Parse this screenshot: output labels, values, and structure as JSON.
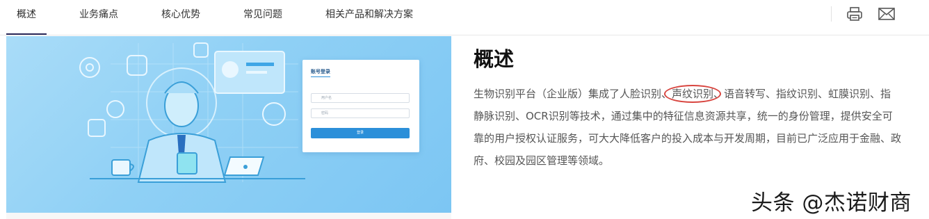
{
  "nav": {
    "tabs": [
      {
        "label": "概述",
        "active": true
      },
      {
        "label": "业务痛点",
        "active": false
      },
      {
        "label": "核心优势",
        "active": false
      },
      {
        "label": "常见问题",
        "active": false
      },
      {
        "label": "相关产品和解决方案",
        "active": false
      }
    ],
    "actions": [
      "printer-icon",
      "mail-icon"
    ]
  },
  "hero": {
    "login_card": {
      "title": "账号登录",
      "username_placeholder": "用户名",
      "password_placeholder": "密码",
      "button_label": "登录"
    }
  },
  "overview": {
    "heading": "概述",
    "text_before": "生物识别平台（企业版）集成了人脸识别、",
    "highlighted": "声纹识别",
    "text_after": "、语音转写、指纹识别、虹膜识别、指静脉识别、OCR识别等技术，通过集中的特征信息资源共享，统一的身份管理，提供安全可靠的用户授权认证服务，可大大降低客户的投入成本与开发周期，目前已广泛应用于金融、政府、校园及园区管理等领域。"
  },
  "watermark": "头条 @杰诺财商",
  "colors": {
    "highlight_circle": "#d8453f",
    "tab_underline": "#2d2a5a",
    "login_button": "#2b8fd9"
  }
}
